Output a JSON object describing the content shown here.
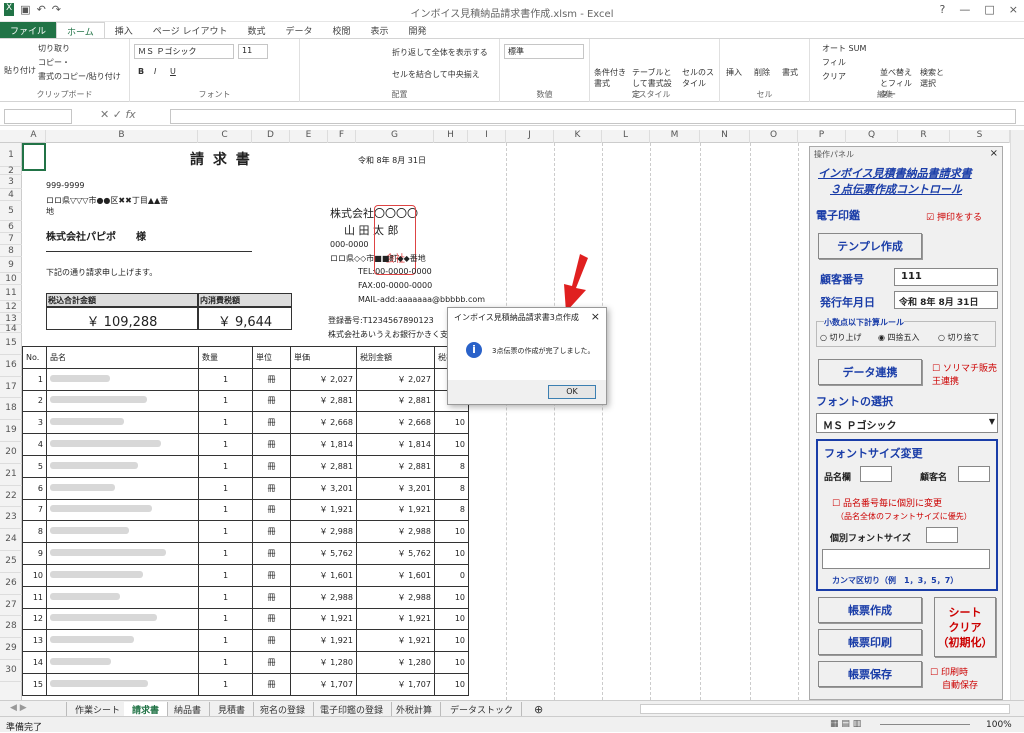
{
  "window": {
    "title": "インボイス見積納品請求書作成.xlsm - Excel",
    "close": "×"
  },
  "tabs": [
    "ファイル",
    "ホーム",
    "挿入",
    "ページ レイアウト",
    "数式",
    "データ",
    "校閲",
    "表示",
    "開発"
  ],
  "ribbon": {
    "clipboard": {
      "paste": "貼り付け",
      "cut": "切り取り",
      "copy": "コピー・",
      "format_painter": "書式のコピー/貼り付け",
      "name": "クリップボード"
    },
    "font": {
      "family": "ＭＳ Ｐゴシック",
      "size": "11",
      "bold": "B",
      "italic": "I",
      "underline": "U",
      "name": "フォント"
    },
    "align": {
      "wrap": "折り返して全体を表示する",
      "merge": "セルを結合して中央揃え",
      "name": "配置"
    },
    "number": {
      "format": "標準",
      "name": "数値"
    },
    "style": {
      "cond": "条件付き書式",
      "table": "テーブルとして書式設定",
      "cell": "セルのスタイル",
      "name": "スタイル"
    },
    "cells": {
      "insert": "挿入",
      "delete": "削除",
      "format": "書式",
      "name": "セル"
    },
    "edit": {
      "autosum": "オート SUM",
      "fill": "フィル",
      "clear": "クリア",
      "sort": "並べ替えとフィルター",
      "find": "検索と選択",
      "name": "編集"
    }
  },
  "columns": [
    "A",
    "B",
    "C",
    "D",
    "E",
    "F",
    "G",
    "H",
    "I",
    "J",
    "K",
    "L",
    "M",
    "N",
    "O",
    "P",
    "Q",
    "R",
    "S"
  ],
  "rows": [
    "1",
    "2",
    "3",
    "4",
    "5",
    "6",
    "7",
    "8",
    "9",
    "10",
    "11",
    "12",
    "13",
    "14",
    "15",
    "16",
    "17",
    "18",
    "19",
    "20",
    "21",
    "22",
    "23",
    "24",
    "25",
    "26",
    "27",
    "28",
    "29",
    "30"
  ],
  "invoice": {
    "title": "請 求 書",
    "date": "令和 8年 8月 31日",
    "zip": "999-9999",
    "addr1": "ロロ県▽▽▽市●●区✖✖丁目▲▲番",
    "addr2": "地",
    "customer": "株式会社パピポ　　様",
    "note": "下記の通り請求申し上げます。",
    "total_label": "税込合計金額",
    "total": "￥ 109,288",
    "tax_label": "内消費税額",
    "tax": "￥ 9,644",
    "company": "株式会社〇〇〇〇",
    "person": "山 田 太 郎",
    "seal": "会社",
    "tel_zip": "000-0000",
    "addr": "ロロ県◇◇市■■町◆◆番地",
    "tel": "TEL:00-0000-0000",
    "fax": "FAX:00-0000-0000",
    "mail": "MAIL-add:aaaaaaa@bbbbb.com",
    "reg": "登録番号:T1234567890123",
    "bank": "株式会社あいうえお銀行かきく支店",
    "headers": [
      "No.",
      "品名",
      "数量",
      "単位",
      "単価",
      "税別金額",
      "税率"
    ],
    "items": [
      {
        "no": "1",
        "qty": "1",
        "unit": "冊",
        "price": "￥ 2,027",
        "amount": "￥ 2,027",
        "tax": "10"
      },
      {
        "no": "2",
        "qty": "1",
        "unit": "冊",
        "price": "￥ 2,881",
        "amount": "￥ 2,881",
        "tax": "10"
      },
      {
        "no": "3",
        "qty": "1",
        "unit": "冊",
        "price": "￥ 2,668",
        "amount": "￥ 2,668",
        "tax": "10"
      },
      {
        "no": "4",
        "qty": "1",
        "unit": "冊",
        "price": "￥ 1,814",
        "amount": "￥ 1,814",
        "tax": "10"
      },
      {
        "no": "5",
        "qty": "1",
        "unit": "冊",
        "price": "￥ 2,881",
        "amount": "￥ 2,881",
        "tax": "8"
      },
      {
        "no": "6",
        "qty": "1",
        "unit": "冊",
        "price": "￥ 3,201",
        "amount": "￥ 3,201",
        "tax": "8"
      },
      {
        "no": "7",
        "qty": "1",
        "unit": "冊",
        "price": "￥ 1,921",
        "amount": "￥ 1,921",
        "tax": "8"
      },
      {
        "no": "8",
        "qty": "1",
        "unit": "冊",
        "price": "￥ 2,988",
        "amount": "￥ 2,988",
        "tax": "10"
      },
      {
        "no": "9",
        "qty": "1",
        "unit": "冊",
        "price": "￥ 5,762",
        "amount": "￥ 5,762",
        "tax": "10"
      },
      {
        "no": "10",
        "qty": "1",
        "unit": "冊",
        "price": "￥ 1,601",
        "amount": "￥ 1,601",
        "tax": "0"
      },
      {
        "no": "11",
        "qty": "1",
        "unit": "冊",
        "price": "￥ 2,988",
        "amount": "￥ 2,988",
        "tax": "10"
      },
      {
        "no": "12",
        "qty": "1",
        "unit": "冊",
        "price": "￥ 1,921",
        "amount": "￥ 1,921",
        "tax": "10"
      },
      {
        "no": "13",
        "qty": "1",
        "unit": "冊",
        "price": "￥ 1,921",
        "amount": "￥ 1,921",
        "tax": "10"
      },
      {
        "no": "14",
        "qty": "1",
        "unit": "冊",
        "price": "￥ 1,280",
        "amount": "￥ 1,280",
        "tax": "10"
      },
      {
        "no": "15",
        "qty": "1",
        "unit": "冊",
        "price": "￥ 1,707",
        "amount": "￥ 1,707",
        "tax": "10"
      }
    ]
  },
  "panel": {
    "title": "操作パネル",
    "heading1": "インボイス見積書納品書請求書",
    "heading2": "３点伝票作成コントロール",
    "seal_label": "電子印鑑",
    "seal_check": "押印をする",
    "template_btn": "テンプレ作成",
    "cust_label": "顧客番号",
    "cust_value": "111",
    "date_label": "発行年月日",
    "date_value": "令和 8年 8月 31日",
    "round_label": "小数点以下計算ルール",
    "round_up": "切り上げ",
    "round_half": "四捨五入",
    "round_down": "切り捨て",
    "data_btn": "データ連携",
    "sorimachi": "ソリマチ販売王連携",
    "font_label": "フォントの選択",
    "font_value": "ＭＳ Ｐゴシック",
    "fsize_label": "フォントサイズ変更",
    "item_col": "品名欄",
    "cust_name": "顧客名",
    "indiv_check": "品名番号毎に個別に変更",
    "indiv_note": "（品名全体のフォントサイズに優先）",
    "indiv_size": "個別フォントサイズ",
    "comma_note": "カンマ区切り（例　1，3，5，7）",
    "create_btn": "帳票作成",
    "print_btn": "帳票印刷",
    "save_btn": "帳票保存",
    "clear_btn1": "シート",
    "clear_btn2": "クリア",
    "clear_btn3": "（初期化）",
    "auto_save1": "印刷時",
    "auto_save2": "自動保存"
  },
  "dialog": {
    "title": "インボイス見積納品請求書3点作成",
    "message": "3点伝票の作成が完了しました。",
    "ok": "OK"
  },
  "sheets": [
    "作業シート",
    "請求書",
    "納品書",
    "見積書",
    "宛名の登録",
    "電子印鑑の登録",
    "外税計算",
    "データストック"
  ],
  "status": {
    "ready": "準備完了",
    "zoom": "100%"
  }
}
